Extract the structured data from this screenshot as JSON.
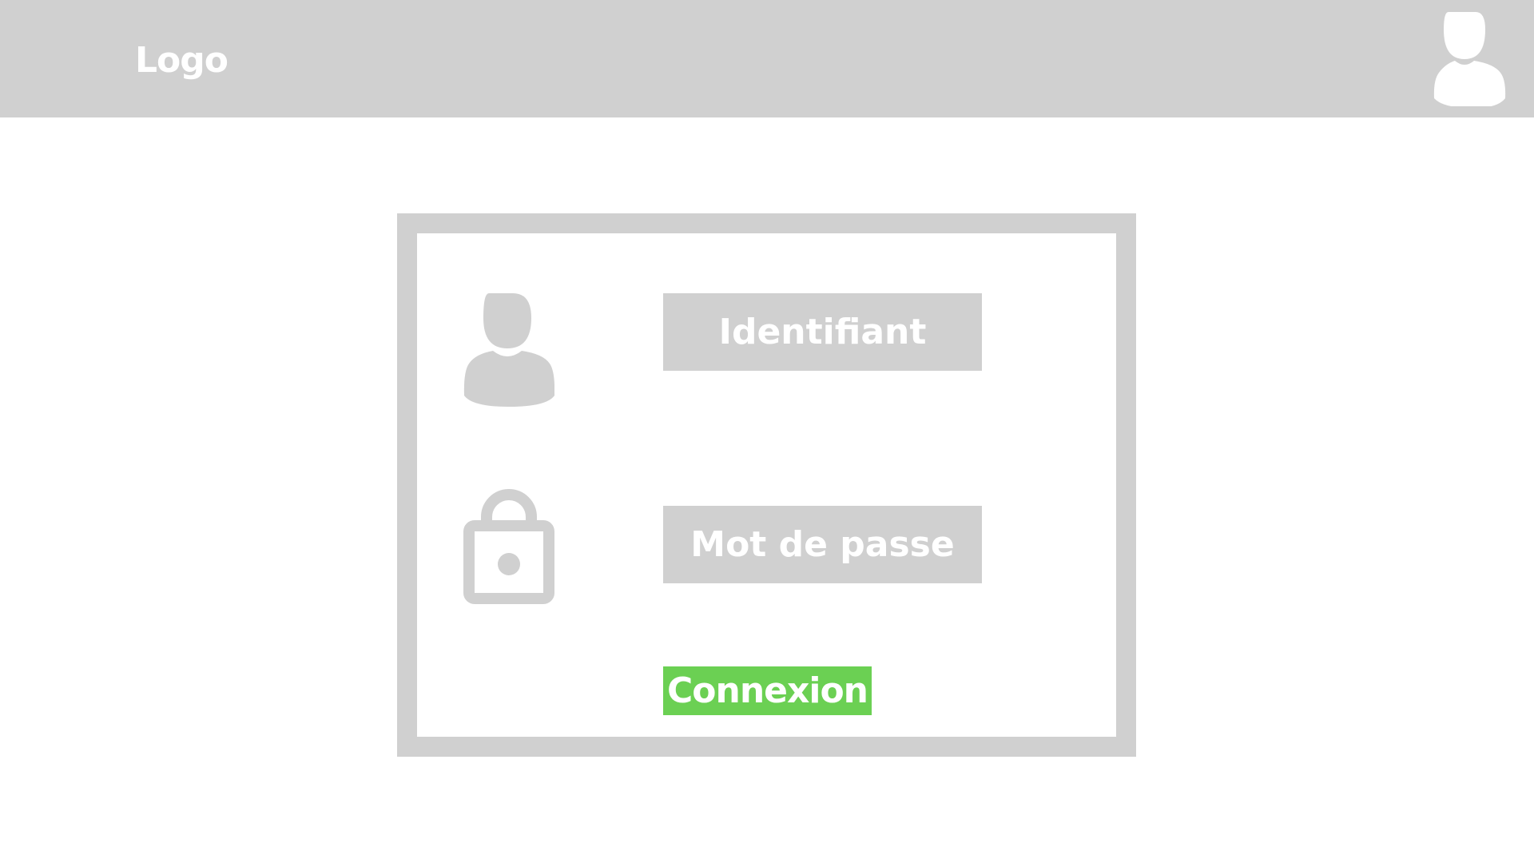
{
  "header": {
    "logo_text": "Logo",
    "account_icon": "user-account-icon"
  },
  "login": {
    "username_icon": "user-icon",
    "username_label": "Identifiant",
    "password_icon": "lock-icon",
    "password_label": "Mot de passe",
    "submit_label": "Connexion"
  },
  "colors": {
    "header_bg": "#d0d0d0",
    "field_bg": "#d0d0d0",
    "button_bg": "#6bd053",
    "text": "#ffffff"
  }
}
